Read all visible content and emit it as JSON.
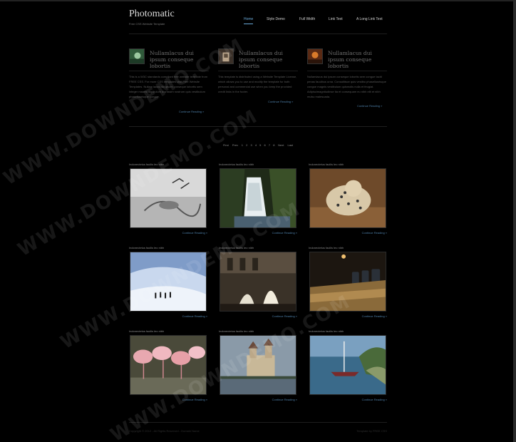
{
  "site": {
    "title": "Photomatic",
    "tagline": "Free CSS Website Template"
  },
  "nav": [
    {
      "label": "Home",
      "active": true
    },
    {
      "label": "Style Demo",
      "active": false
    },
    {
      "label": "Full Width",
      "active": false
    },
    {
      "label": "Link Text",
      "active": false
    },
    {
      "label": "A Long Link Text",
      "active": false
    }
  ],
  "features": [
    {
      "title": "Nullamlacus dui ipsum conseque lobortis",
      "body": "This is a W3C standards compliant free website template from FREE CSS. For more CSS templates visit Free Website Templates. Nullam lacus dui ipsum conseque lobortis sem integer mauris dapibulum dignissim nostrum quis vestibulum phasellusrisque congue.",
      "more": "Continue Reading »"
    },
    {
      "title": "Nullamlacus dui ipsum conseque lobortis",
      "body": "This template is distributed using a Website Template License, which allows you to use and modify the template for both personal and commercial use when you keep the provided credit links in the footer.",
      "more": "Continue Reading »"
    },
    {
      "title": "Nullamlacus dui ipsum conseque lobortis",
      "body": "Nullamlacus dui ipsum conseque lobortis sem congue taciti penas faucibus urna. Consalitisce quis vestibu phasellusrisque congue magnis vestibulum quismolis nulla et feugiat. Adipiscimagnitudinse tia et consequam eu nibh elit et nibh mulsc malesuada.",
      "more": "Continue Reading »"
    }
  ],
  "pager": {
    "first": "First",
    "prev": "Prev",
    "pages": [
      "1",
      "2",
      "3",
      "4",
      "5",
      "6",
      "7",
      "8"
    ],
    "next": "Next",
    "last": "Last"
  },
  "gallery": [
    {
      "title": "Indonectetus facilis leo nibh",
      "more": "Continue Reading »",
      "photo": "birds-water-icon"
    },
    {
      "title": "Indonectetus facilis leo nibh",
      "more": "Continue Reading »",
      "photo": "waterfall-icon"
    },
    {
      "title": "Indonectetus facilis leo nibh",
      "more": "Continue Reading »",
      "photo": "leopard-icon"
    },
    {
      "title": "Indonectetus facilis leo nibh",
      "more": "Continue Reading »",
      "photo": "snow-hikers-icon"
    },
    {
      "title": "Indonectetus facilis leo nibh",
      "more": "Continue Reading »",
      "photo": "fountain-icon"
    },
    {
      "title": "Indonectetus facilis leo nibh",
      "more": "Continue Reading »",
      "photo": "boardroom-icon"
    },
    {
      "title": "Indonectetus facilis leo nibh",
      "more": "Continue Reading »",
      "photo": "flamingos-icon"
    },
    {
      "title": "Indonectetus facilis leo nibh",
      "more": "Continue Reading »",
      "photo": "castle-lake-icon"
    },
    {
      "title": "Indonectetus facilis leo nibh",
      "more": "Continue Reading »",
      "photo": "sailboat-coast-icon"
    }
  ],
  "footer": {
    "copyright": "Copyright © 2012 - All Rights Reserved - Domain Name",
    "credit": "Template by FREE CSS"
  },
  "watermark": "WWW.DOWNDEMO.COM",
  "colors": {
    "background": "#000000",
    "accent": "#6aa9d8",
    "link": "#4d7fa8"
  }
}
